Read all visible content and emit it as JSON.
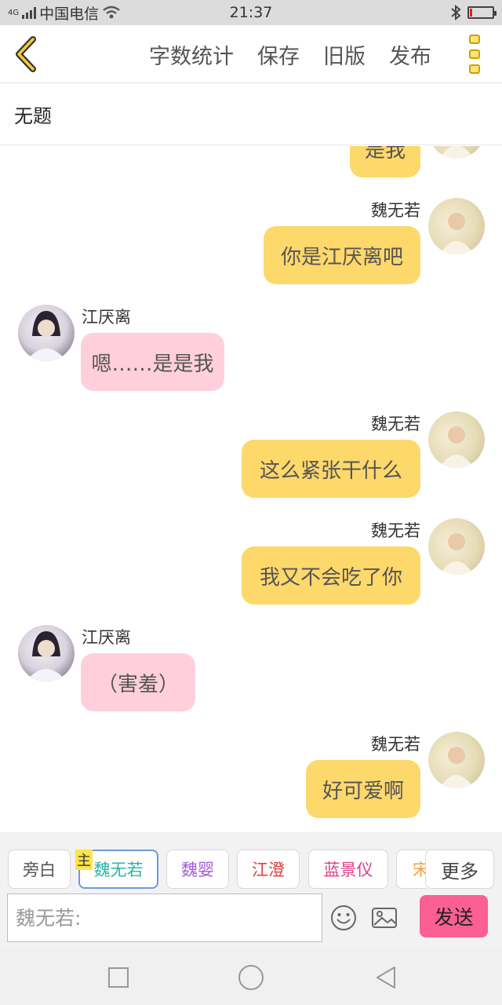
{
  "status_bar": {
    "network": "4G",
    "carrier": "中国电信",
    "time": "21:37",
    "icons": [
      "signal-icon",
      "wifi-icon",
      "bluetooth-icon",
      "battery-icon"
    ],
    "battery_level": 0.08
  },
  "nav": {
    "back_icon": "chevron-left-icon",
    "buttons": [
      "字数统计",
      "保存",
      "旧版",
      "发布"
    ],
    "menu_icon": "more-vertical-icon"
  },
  "title": "无题",
  "messages": [
    {
      "side": "right",
      "text": "是我",
      "partial": true
    },
    {
      "side": "right",
      "name": "魏无若",
      "text": "你是江厌离吧"
    },
    {
      "side": "left",
      "name": "江厌离",
      "text": "嗯……是是我"
    },
    {
      "side": "right",
      "name": "魏无若",
      "text": "这么紧张干什么"
    },
    {
      "side": "right",
      "name": "魏无若",
      "text": "我又不会吃了你"
    },
    {
      "side": "left",
      "name": "江厌离",
      "text": "（害羞）"
    },
    {
      "side": "right",
      "name": "魏无若",
      "text": "好可爱啊"
    }
  ],
  "roles": {
    "host_tag": "主",
    "items": [
      {
        "label": "旁白",
        "color": "#555555"
      },
      {
        "label": "魏无若",
        "color": "#2bb5a8",
        "active": true
      },
      {
        "label": "魏婴",
        "color": "#a25ad6"
      },
      {
        "label": "江澄",
        "color": "#e43c3c"
      },
      {
        "label": "蓝景仪",
        "color": "#e23d8a"
      },
      {
        "label": "宋",
        "color": "#f0a040"
      }
    ],
    "more_label": "更多"
  },
  "composer": {
    "placeholder": "魏无若:",
    "emoji_icon": "emoji-icon",
    "image_icon": "image-icon",
    "send_label": "发送"
  },
  "system_nav": [
    "recent-apps-icon",
    "home-icon",
    "back-triangle-icon"
  ],
  "colors": {
    "my_bubble": "#fdd86b",
    "other_bubble": "#ffd0dc",
    "send_button": "#fb5f94",
    "accent": "#c9a100"
  }
}
